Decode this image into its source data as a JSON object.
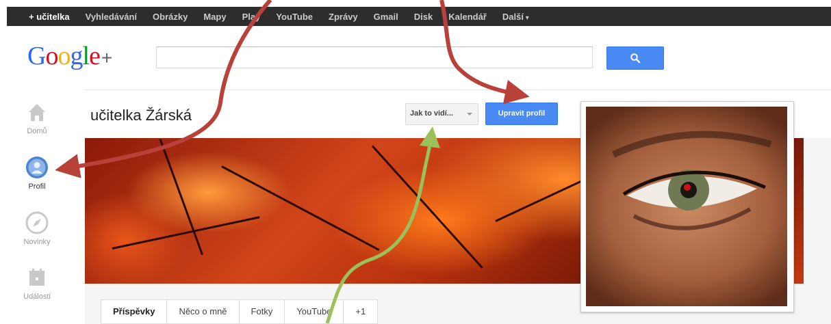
{
  "topbar": {
    "items": [
      "+ učitelka",
      "Vyhledávání",
      "Obrázky",
      "Mapy",
      "Play",
      "YouTube",
      "Zprávy",
      "Gmail",
      "Disk",
      "Kalendář",
      "Další"
    ]
  },
  "header": {
    "logo_text": "Google",
    "logo_plus": "+",
    "search_placeholder": ""
  },
  "rail": {
    "items": [
      {
        "label": "Domů",
        "icon": "home-icon"
      },
      {
        "label": "Profil",
        "icon": "profile-icon"
      },
      {
        "label": "Novinky",
        "icon": "compass-icon"
      },
      {
        "label": "Události",
        "icon": "calendar-icon"
      }
    ]
  },
  "profile": {
    "name": "učitelka Žárská",
    "view_as": "Jak to vidí...",
    "edit_button": "Upravit profil",
    "tabs": [
      "Příspěvky",
      "Něco o mně",
      "Fotky",
      "YouTube",
      "+1"
    ]
  },
  "colors": {
    "accent_blue": "#4a8af4",
    "arrow_red": "#b8423a",
    "arrow_green": "#9bc25a"
  }
}
